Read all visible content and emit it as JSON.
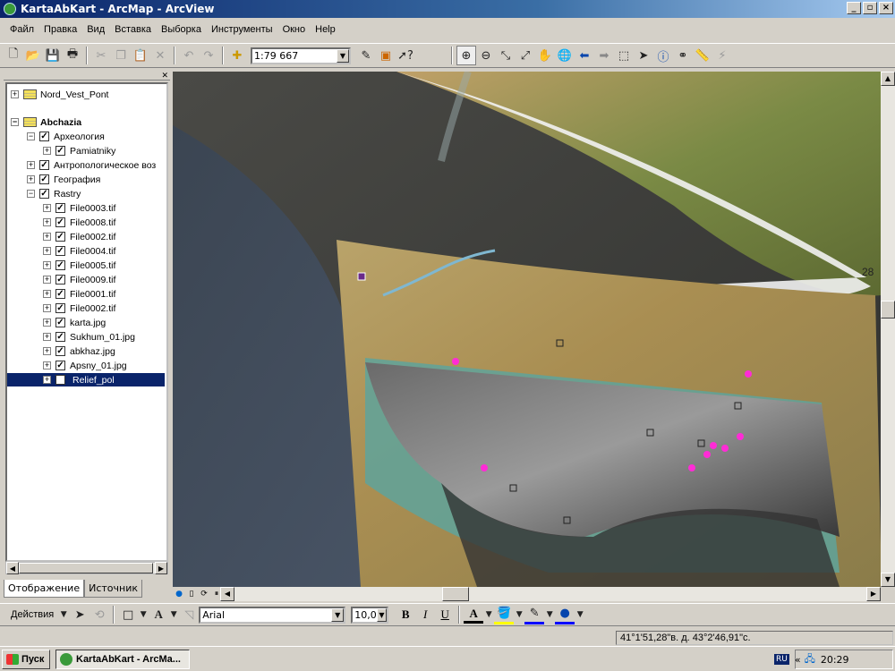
{
  "window": {
    "title": "KartaAbKart - ArcMap - ArcView",
    "controls": [
      "_",
      "▫",
      "×"
    ]
  },
  "menu": [
    {
      "label": "Файл"
    },
    {
      "label": "Правка"
    },
    {
      "label": "Вид"
    },
    {
      "label": "Вставка"
    },
    {
      "label": "Выборка"
    },
    {
      "label": "Инструменты"
    },
    {
      "label": "Окно"
    },
    {
      "label": "Help"
    }
  ],
  "toolbar": {
    "scale": "1:79 667"
  },
  "toc": {
    "tree": [
      {
        "label": "Nord_Vest_Pont",
        "level": 0,
        "type": "group",
        "checked": false,
        "expander": "+"
      },
      {
        "label": "Abchazia",
        "level": 0,
        "type": "group",
        "checked": false,
        "expander": "−",
        "bold": true
      },
      {
        "label": "Археология",
        "level": 1,
        "checked": true,
        "expander": "−"
      },
      {
        "label": "Pamiatniky",
        "level": 2,
        "checked": true,
        "expander": "+"
      },
      {
        "label": "Антропологическое воз",
        "level": 1,
        "checked": true,
        "expander": "+"
      },
      {
        "label": "География",
        "level": 1,
        "checked": true,
        "expander": "+"
      },
      {
        "label": "Rastry",
        "level": 1,
        "checked": true,
        "expander": "−"
      },
      {
        "label": "File0003.tif",
        "level": 2,
        "checked": true,
        "expander": "+"
      },
      {
        "label": "File0008.tif",
        "level": 2,
        "checked": true,
        "expander": "+"
      },
      {
        "label": "File0002.tif",
        "level": 2,
        "checked": true,
        "expander": "+"
      },
      {
        "label": "File0004.tif",
        "level": 2,
        "checked": true,
        "expander": "+"
      },
      {
        "label": "File0005.tif",
        "level": 2,
        "checked": true,
        "expander": "+"
      },
      {
        "label": "File0009.tif",
        "level": 2,
        "checked": true,
        "expander": "+"
      },
      {
        "label": "File0001.tif",
        "level": 2,
        "checked": true,
        "expander": "+"
      },
      {
        "label": "File0002.tif",
        "level": 2,
        "checked": true,
        "expander": "+"
      },
      {
        "label": "karta.jpg",
        "level": 2,
        "checked": true,
        "expander": "+"
      },
      {
        "label": "Sukhum_01.jpg",
        "level": 2,
        "checked": true,
        "expander": "+"
      },
      {
        "label": "abkhaz.jpg",
        "level": 2,
        "checked": true,
        "expander": "+"
      },
      {
        "label": "Apsny_01.jpg",
        "level": 2,
        "checked": true,
        "expander": "+"
      },
      {
        "label": "Relief_pol",
        "level": 2,
        "checked": true,
        "expander": "+",
        "selected": true
      }
    ],
    "tabs": {
      "display": "Отображение",
      "source": "Источник"
    }
  },
  "map": {
    "label_fragment": "28"
  },
  "drawing": {
    "actions_label": "Действия",
    "font": "Arial",
    "size": "10,0",
    "bold": "B",
    "italic": "I",
    "underline": "U",
    "font_color_label": "A"
  },
  "status": {
    "coordinates": "41°1'51,28\"в. д.  43°2'46,91\"с."
  },
  "taskbar": {
    "start_label": "Пуск",
    "task_label": "KartaAbKart - ArcMa...",
    "lang": "RU",
    "time": "20:29"
  },
  "colors": {
    "title_start": "#0a246a",
    "title_end": "#a6caf0",
    "selection": "#0a246a",
    "marker_pink": "#ff2bd6"
  }
}
